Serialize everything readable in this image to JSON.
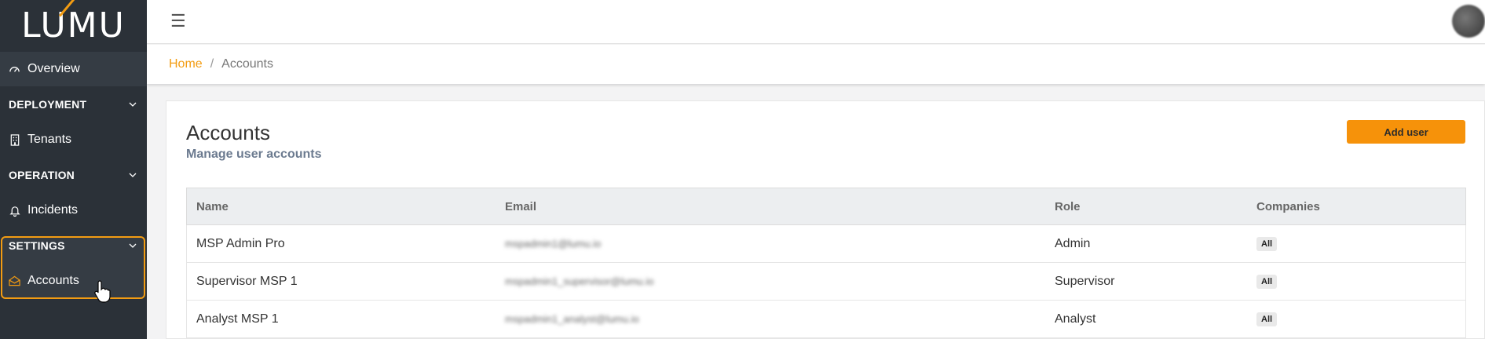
{
  "brand": {
    "logo_text": "LUMU",
    "accent_color": "#f39c12"
  },
  "sidebar": {
    "overview": "Overview",
    "sections": [
      {
        "label": "DEPLOYMENT",
        "items": [
          "Tenants"
        ]
      },
      {
        "label": "OPERATION",
        "items": [
          "Incidents"
        ]
      },
      {
        "label": "SETTINGS",
        "items": [
          "Accounts"
        ]
      }
    ],
    "active_item": "Accounts"
  },
  "topbar": {
    "menu_icon": "hamburger-icon",
    "avatar": "avatar"
  },
  "breadcrumb": {
    "home": "Home",
    "separator": "/",
    "current": "Accounts"
  },
  "page": {
    "title": "Accounts",
    "subtitle": "Manage user accounts",
    "add_button": "Add user"
  },
  "table": {
    "columns": [
      "Name",
      "Email",
      "Role",
      "Companies"
    ],
    "rows": [
      {
        "name": "MSP Admin Pro",
        "email": "mspadmin1@lumu.io",
        "role": "Admin",
        "companies": "All"
      },
      {
        "name": "Supervisor MSP 1",
        "email": "mspadmin1_supervisor@lumu.io",
        "role": "Supervisor",
        "companies": "All"
      },
      {
        "name": "Analyst MSP 1",
        "email": "mspadmin1_analyst@lumu.io",
        "role": "Analyst",
        "companies": "All"
      }
    ]
  }
}
